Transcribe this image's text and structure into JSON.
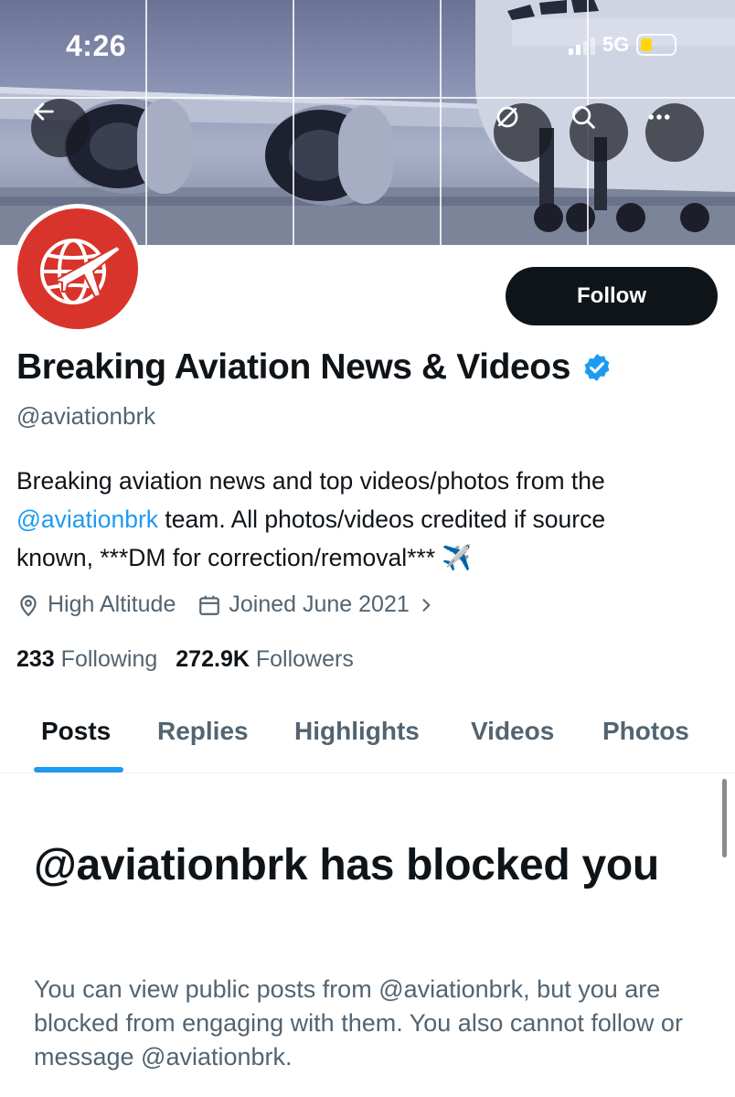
{
  "status_bar": {
    "time": "4:26",
    "network": "5G",
    "battery_color": "#ffd60a"
  },
  "header": {
    "back_icon": "arrow-left-icon",
    "action_icons": [
      "hide-icon",
      "search-icon",
      "more-icon"
    ]
  },
  "profile": {
    "display_name": "Breaking Aviation News & Videos",
    "verified_badge_color": "#1d9bf0",
    "handle": "@aviationbrk",
    "follow_label": "Follow",
    "bio": {
      "line1": "Breaking aviation news and top videos/photos from the",
      "mention": "@aviationbrk",
      "line2_rest": " team. All photos/videos credited if source",
      "line3": "known, ***DM for correction/removal*** ✈️"
    },
    "location": "High Altitude",
    "joined": "Joined June 2021",
    "following_count": "233",
    "following_label": "Following",
    "followers_count": "272.9K",
    "followers_label": "Followers"
  },
  "tabs": [
    {
      "label": "Posts",
      "active": true
    },
    {
      "label": "Replies",
      "active": false
    },
    {
      "label": "Highlights",
      "active": false
    },
    {
      "label": "Videos",
      "active": false
    },
    {
      "label": "Photos",
      "active": false
    }
  ],
  "blocked": {
    "title": "@aviationbrk has blocked you",
    "body": "You can view public posts from @aviationbrk, but you are blocked from engaging with them. You also cannot follow or message @aviationbrk."
  },
  "colors": {
    "accent": "#1d9bf0",
    "text_primary": "#0f1419",
    "text_secondary": "#536471",
    "avatar_red": "#d9342b"
  }
}
